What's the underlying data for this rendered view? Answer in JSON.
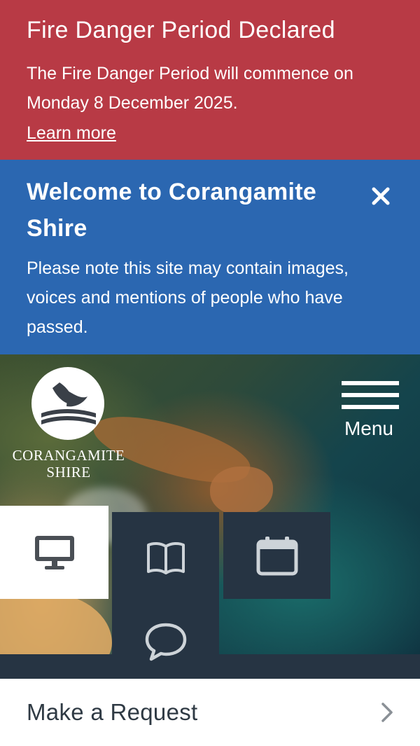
{
  "fire_alert": {
    "title": "Fire Danger Period Declared",
    "message": "The Fire Danger Period will commence on Monday 8 December 2025.",
    "link": "Learn more",
    "background": "#b83a45"
  },
  "welcome": {
    "title": "Welcome to Corangamite Shire",
    "message": "Please note this site may contain images, voices and mentions of people who have passed.",
    "close_icon": "close-icon",
    "background": "#2b67b1"
  },
  "header": {
    "logo_line1": "CORANGAMITE",
    "logo_line2": "SHIRE",
    "menu_label": "Menu"
  },
  "quick_links": [
    {
      "icon": "computer-icon"
    },
    {
      "icon": "book-icon"
    },
    {
      "icon": "calendar-icon"
    },
    {
      "icon": "chat-icon"
    }
  ],
  "request_row": {
    "label": "Make a Request",
    "icon": "chevron-right-icon"
  },
  "colors": {
    "tile_dark": "#263443",
    "icon_grey": "#cdd3d8"
  }
}
